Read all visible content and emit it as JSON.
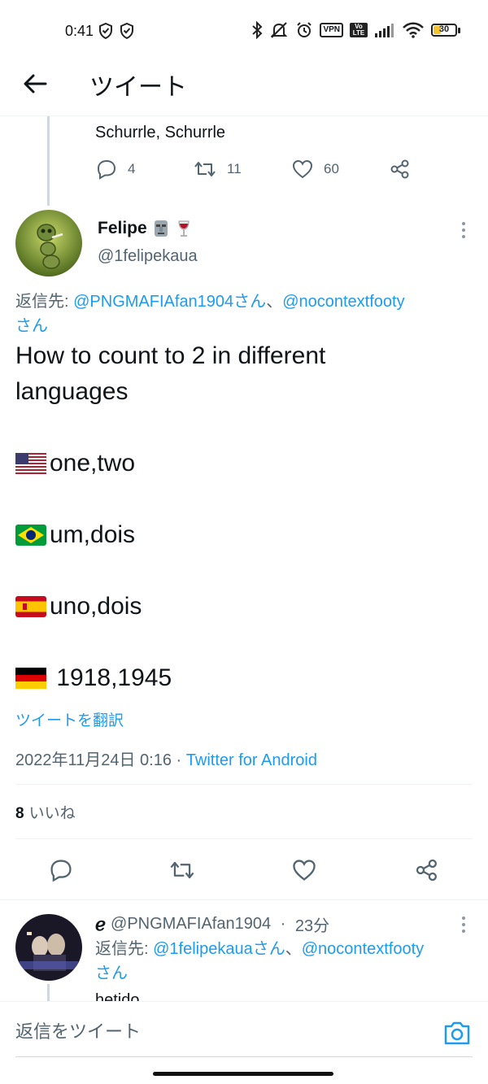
{
  "status_bar": {
    "time": "0:41",
    "vpn": "VPN",
    "volte": "Vo LTE",
    "battery_level": "30"
  },
  "header": {
    "title": "ツイート"
  },
  "previous_tweet": {
    "text_visible": "Schurrle, Schurrle",
    "replies": "4",
    "retweets": "11",
    "likes": "60"
  },
  "main_tweet": {
    "display_name": "Felipe",
    "handle": "@1felipekaua",
    "replying_prefix": "返信先: ",
    "replying_mention_1": "@PNGMAFIAfan1904さん",
    "replying_sep": "、",
    "replying_mention_2": "@nocontextfooty",
    "replying_suffix": "さん",
    "body_line_1": "How to count to 2 in different",
    "body_line_2": "languages",
    "line_us": "one,two",
    "line_br": "um,dois",
    "line_es": "uno,dois",
    "line_de": " 1918,1945",
    "translate_label": "ツイートを翻訳",
    "timestamp": "2022年11月24日 0:16",
    "timestamp_sep": " · ",
    "source": "Twitter for Android",
    "likes_count": "8",
    "likes_label": "いいね"
  },
  "reply_tweet": {
    "name_glyph": "ℯ",
    "handle": "@PNGMAFIAfan1904",
    "time_sep": " · ",
    "time": "23分",
    "replying_prefix": "返信先: ",
    "replying_mention_1": "@1felipekauaさん",
    "replying_sep": "、",
    "replying_mention_2": "@nocontextfooty",
    "replying_suffix": "さん",
    "text_cut": "hetido"
  },
  "reply_bar": {
    "placeholder": "返信をツイート"
  },
  "colors": {
    "accent": "#1d9bf0",
    "secondary_text": "#536471",
    "primary_text": "#0f1419"
  }
}
